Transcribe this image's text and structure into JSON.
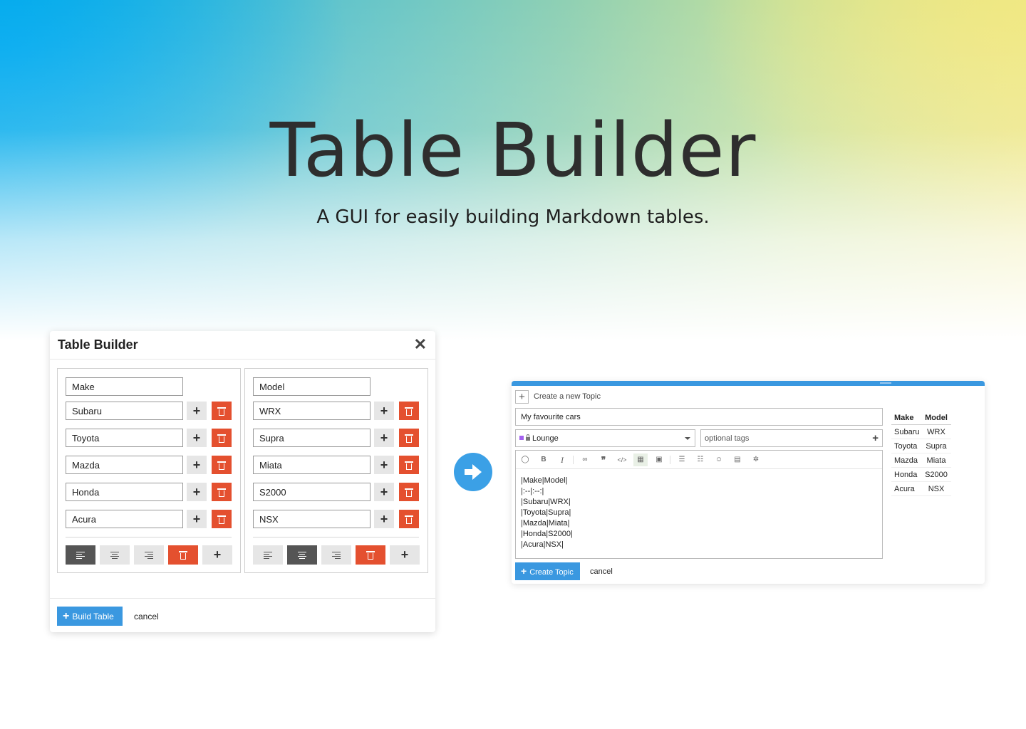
{
  "hero": {
    "title": "Table Builder",
    "subtitle": "A GUI for easily building Markdown tables."
  },
  "modal": {
    "title": "Table Builder",
    "close_icon": "close-icon",
    "columns": [
      {
        "header": "Make",
        "cells": [
          "Subaru",
          "Toyota",
          "Mazda",
          "Honda",
          "Acura"
        ],
        "active_alignment": "left"
      },
      {
        "header": "Model",
        "cells": [
          "WRX",
          "Supra",
          "Miata",
          "S2000",
          "NSX"
        ],
        "active_alignment": "center"
      }
    ],
    "build_label": "Build Table",
    "cancel_label": "cancel"
  },
  "composer": {
    "action": "Create a new Topic",
    "title_value": "My favourite cars",
    "category": "Lounge",
    "category_color": "#a461ef",
    "tags_placeholder": "optional tags",
    "markdown": [
      "|Make|Model|",
      "|:--|:--:|",
      "|Subaru|WRX|",
      "|Toyota|Supra|",
      "|Mazda|Miata|",
      "|Honda|S2000|",
      "|Acura|NSX|"
    ],
    "create_label": "Create Topic",
    "cancel_label": "cancel"
  },
  "preview": {
    "headers": [
      "Make",
      "Model"
    ],
    "rows": [
      [
        "Subaru",
        "WRX"
      ],
      [
        "Toyota",
        "Supra"
      ],
      [
        "Mazda",
        "Miata"
      ],
      [
        "Honda",
        "S2000"
      ],
      [
        "Acura",
        "NSX"
      ]
    ]
  },
  "colors": {
    "accent": "#3a98e0",
    "danger": "#e4502f"
  }
}
